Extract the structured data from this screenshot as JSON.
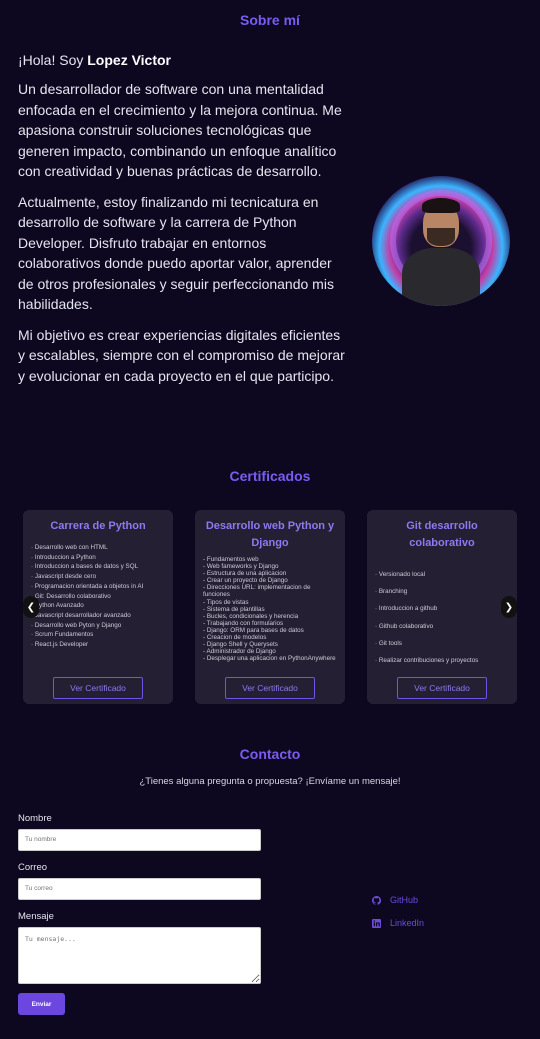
{
  "about": {
    "title": "Sobre mí",
    "greeting_prefix": "¡Hola! Soy ",
    "name": "Lopez Victor",
    "paragraphs": [
      "Un desarrollador de software con una mentalidad enfocada en el crecimiento y la mejora continua. Me apasiona construir soluciones tecnológicas que generen impacto, combinando un enfoque analítico con creatividad y buenas prácticas de desarrollo.",
      "Actualmente, estoy finalizando mi tecnicatura en desarrollo de software y la carrera de Python Developer. Disfruto trabajar en entornos colaborativos donde puedo aportar valor, aprender de otros profesionales y seguir perfeccionando mis habilidades.",
      "Mi objetivo es crear experiencias digitales eficientes y escalables, siempre con el compromiso de mejorar y evolucionar en cada proyecto en el que participo."
    ]
  },
  "certificates": {
    "title": "Certificados",
    "prev_glyph": "❮",
    "next_glyph": "❯",
    "cards": [
      {
        "title": "Carrera de Python",
        "items": [
          "· Desarrollo web con HTML",
          "· Introduccion a Python",
          "· Introduccion a bases de datos y SQL",
          "· Javascript desde cero",
          "· Programacion orientada a objetos in AI",
          "· Git: Desarrollo colaborativo",
          "· Python Avanzado",
          "· Javascript desarrollador avanzado",
          "· Desarrollo web Pyton y Django",
          "· Scrum Fundamentos",
          "· React.js Developer"
        ],
        "button": "Ver Certificado"
      },
      {
        "title": "Desarrollo web Python y Django",
        "items": [
          "- Fundamentos web",
          "- Web fameworks y Django",
          "- Estructura de una aplicacion",
          "- Crear un proyecto de Django",
          "- Direcciones URL: implementacion de funciones",
          "- Tipos de vistas",
          "- Sistema de plantillas",
          "- Bucles, condicionales y herencia",
          "- Trabajando con formularios",
          "- Django: ORM para bases de datos",
          "- Creacion de modelos",
          "- Django Shell y Querysets",
          "- Administrador de Django",
          "- Desplegar una aplicacion en PythonAnywhere"
        ],
        "button": "Ver Certificado"
      },
      {
        "title": "Git desarrollo colaborativo",
        "items": [
          "· Versionado local",
          "· Branching",
          "· Introduccion a github",
          "· Github colaborativo",
          "· Git tools",
          "· Realizar contribuciones y proyectos"
        ],
        "button": "Ver Certificado"
      }
    ]
  },
  "contact": {
    "title": "Contacto",
    "subtitle": "¿Tienes alguna pregunta o propuesta? ¡Envíame un mensaje!",
    "name_label": "Nombre",
    "name_placeholder": "Tu nombre",
    "email_label": "Correo",
    "email_placeholder": "Tu correo",
    "message_label": "Mensaje",
    "message_placeholder": "Tu mensaje...",
    "send_label": "Enviar",
    "github_label": "GitHub",
    "linkedin_label": "LinkedIn"
  },
  "colors": {
    "background": "#0d0820",
    "accent": "#7b5cf0",
    "card": "#241f33",
    "button": "#6b47e0"
  }
}
